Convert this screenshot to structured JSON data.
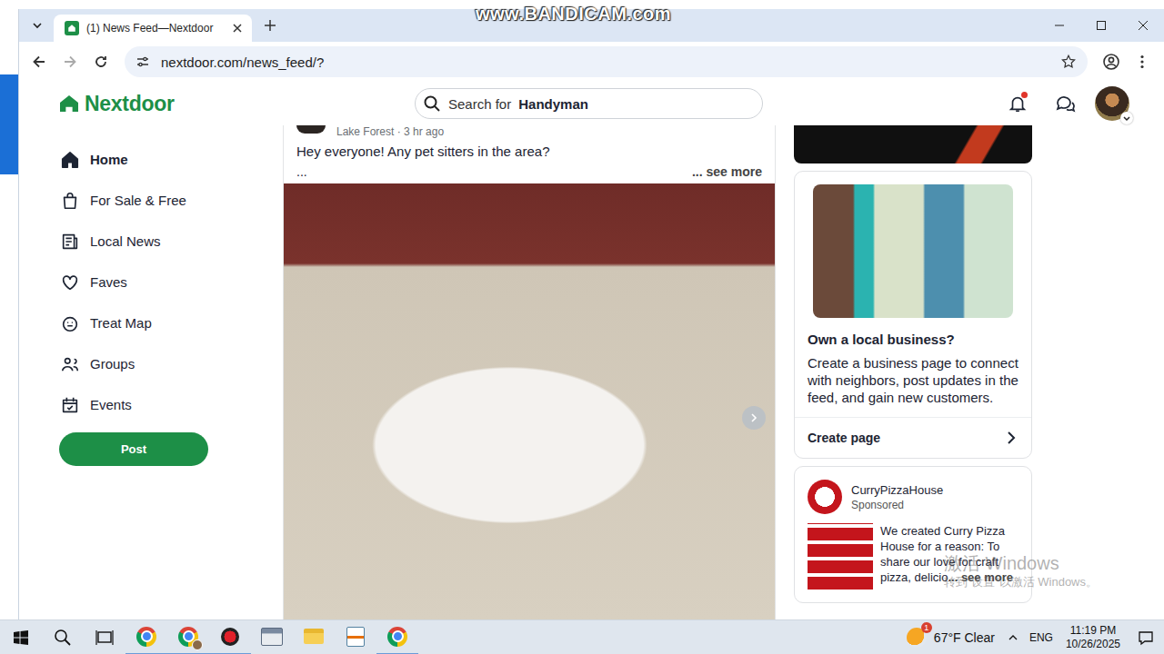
{
  "recorder": {
    "watermark": "www.BANDICAM.com"
  },
  "browser": {
    "tabs": [
      {
        "title": "(1) News Feed—Nextdoor",
        "selected": true
      }
    ],
    "url": "nextdoor.com/news_feed/?",
    "bookmarked": false
  },
  "header": {
    "logo": "Nextdoor",
    "search": {
      "prefix": "Search for",
      "term": "Handyman"
    },
    "notifications_unread": true
  },
  "nav": {
    "items": [
      {
        "label": "Home",
        "selected": true
      },
      {
        "label": "For Sale & Free",
        "selected": false
      },
      {
        "label": "Local News",
        "selected": false
      },
      {
        "label": "Faves",
        "selected": false
      },
      {
        "label": "Treat Map",
        "selected": false
      },
      {
        "label": "Groups",
        "selected": false
      },
      {
        "label": "Events",
        "selected": false
      }
    ],
    "post_button": "Post"
  },
  "post": {
    "meta": "Lake Forest · 3 hr ago",
    "text": "Hey everyone! Any pet sitters in the area?",
    "ellipsis": "...",
    "see_more": "... see more"
  },
  "business_card": {
    "title": "Own a local business?",
    "body": "Create a business page to connect with neighbors, post updates in the feed, and gain new customers.",
    "action": "Create page"
  },
  "sponsored": {
    "name": "CurryPizzaHouse",
    "label": "Sponsored",
    "body": "We created Curry Pizza House for a reason: To share our love for craft pizza, delicio",
    "see_more": "... see more"
  },
  "activation": {
    "title": "激活 Windows",
    "hint": "转到“设置”以激活 Windows。"
  },
  "taskbar": {
    "apps": [
      {
        "running": true
      },
      {
        "running": true
      },
      {
        "running": true
      },
      {
        "running": false
      },
      {
        "running": false
      },
      {
        "running": false
      },
      {
        "running": true
      }
    ],
    "weather": {
      "reading": "67°F Clear",
      "badge": "1"
    },
    "language": "ENG",
    "time": "11:19 PM",
    "date": "10/26/2025"
  }
}
